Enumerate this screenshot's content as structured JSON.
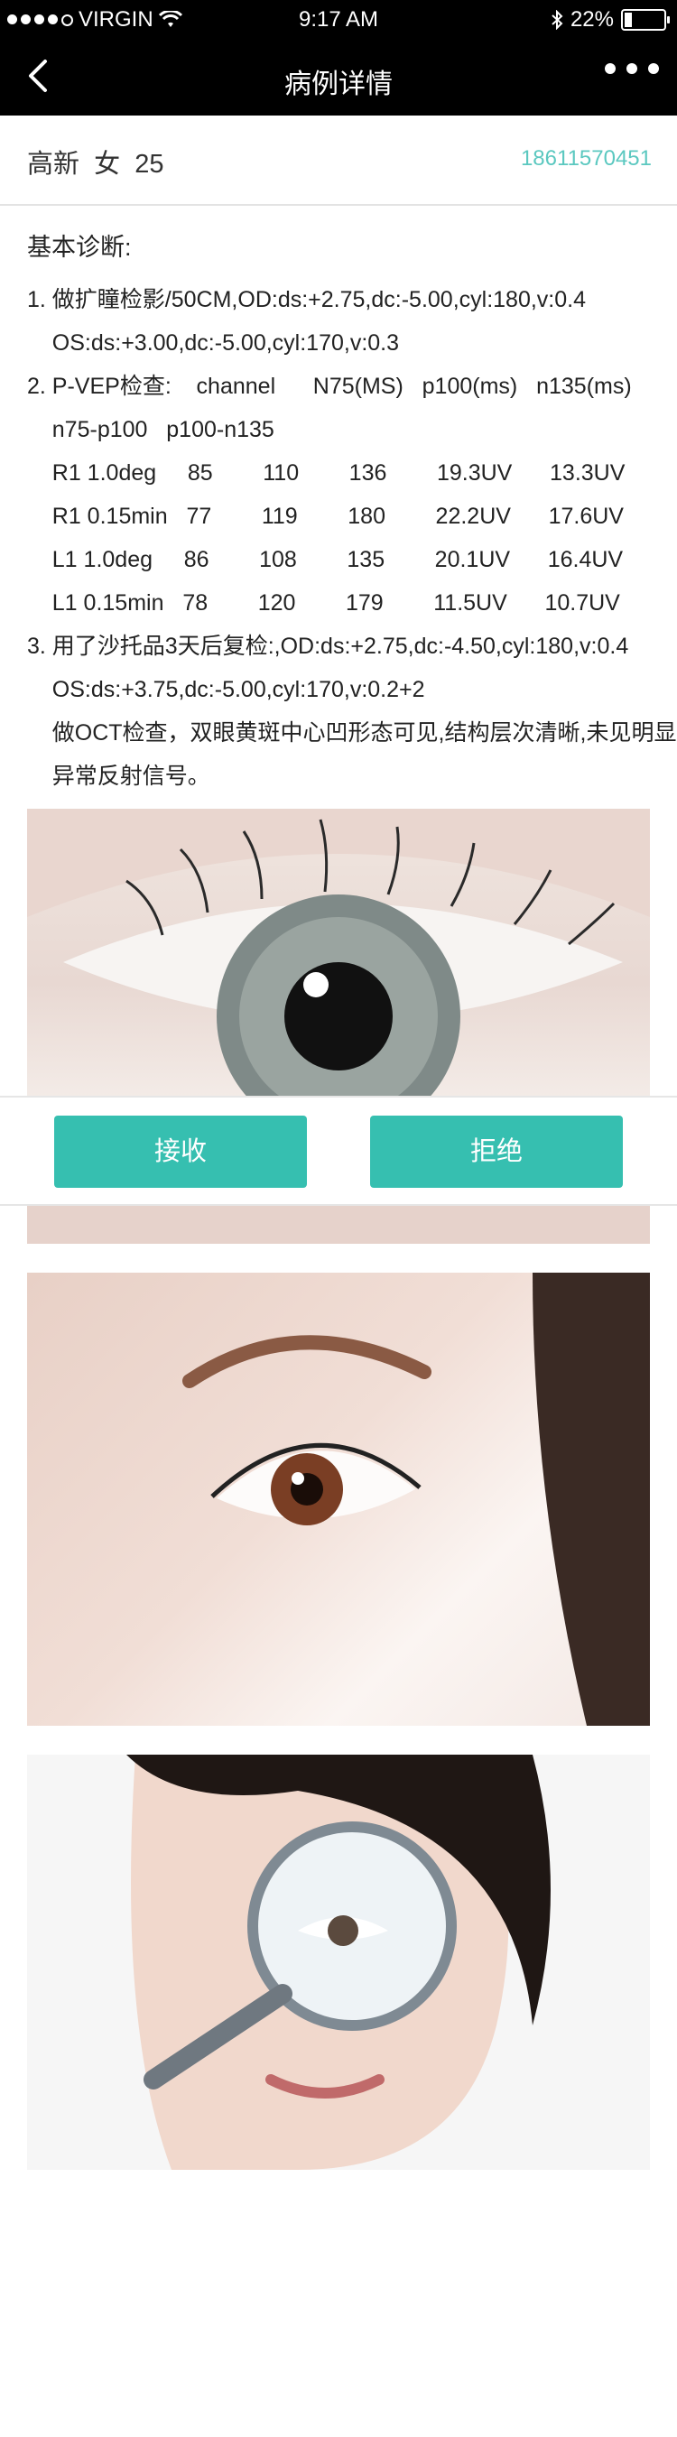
{
  "status_bar": {
    "carrier": "VIRGIN",
    "time": "9:17 AM",
    "battery": "22%",
    "battery_level": 0.22
  },
  "nav": {
    "title": "病例详情"
  },
  "patient": {
    "name": "高新",
    "gender": "女",
    "age": "25",
    "phone": "18611570451"
  },
  "diagnosis": {
    "heading": "基本诊断:",
    "lines": [
      "1. 做扩瞳检影/50CM,OD:ds:+2.75,dc:-5.00,cyl:180,v:0.4",
      "    OS:ds:+3.00,dc:-5.00,cyl:170,v:0.3",
      "2. P-VEP检查:    channel      N75(MS)   p100(ms)   n135(ms)",
      "    n75-p100   p100-n135",
      "    R1 1.0deg     85        110        136        19.3UV      13.3UV",
      "    R1 0.15min   77        119        180        22.2UV      17.6UV",
      "    L1 1.0deg     86        108        135        20.1UV      16.4UV",
      "    L1 0.15min   78        120        179        11.5UV      10.7UV",
      "3. 用了沙托品3天后复检:,OD:ds:+2.75,dc:-4.50,cyl:180,v:0.4",
      "    OS:ds:+3.75,dc:-5.00,cyl:170,v:0.2+2",
      "    做OCT检查，双眼黄斑中心凹形态可见,结构层次清晰,未见明显",
      "    异常反射信号。"
    ]
  },
  "actions": {
    "accept": "接收",
    "reject": "拒绝"
  },
  "icons": {
    "back": "back-arrow-icon",
    "more": "more-dots-icon",
    "wifi": "wifi-icon",
    "bluetooth": "bluetooth-icon"
  },
  "colors": {
    "accent": "#36bfb0",
    "phone": "#5bc8c0"
  }
}
